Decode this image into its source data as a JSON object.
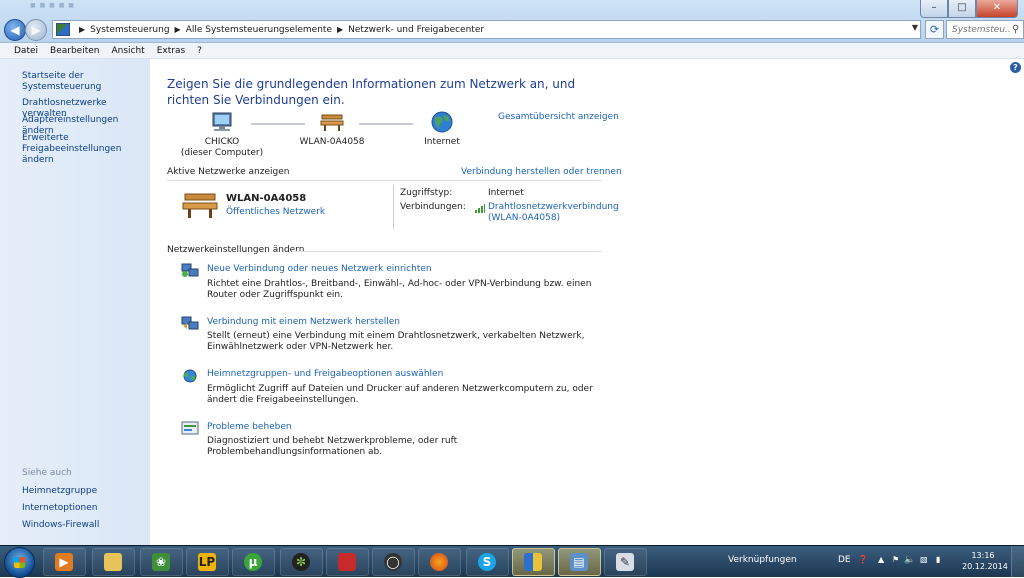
{
  "address_bar": {
    "crumbs": [
      "Systemsteuerung",
      "Alle Systemsteuerungselemente",
      "Netzwerk- und Freigabecenter"
    ],
    "search_placeholder": "Systemsteu..."
  },
  "menu": [
    "Datei",
    "Bearbeiten",
    "Ansicht",
    "Extras",
    "?"
  ],
  "sidebar": {
    "items": [
      "Startseite der Systemsteuerung",
      "Drahtlosnetzwerke verwalten",
      "Adaptereinstellungen ändern",
      "Erweiterte Freigabeeinstellungen ändern"
    ],
    "see_also_caption": "Siehe auch",
    "see_also": [
      "Heimnetzgruppe",
      "Internetoptionen",
      "Windows-Firewall"
    ]
  },
  "main": {
    "heading": "Zeigen Sie die grundlegenden Informationen zum Netzwerk an, und richten Sie Verbindungen ein.",
    "map": {
      "computer_name": "CHICKO",
      "computer_sub": "(dieser Computer)",
      "network_name": "WLAN-0A4058",
      "internet_label": "Internet",
      "full_map_link": "Gesamtübersicht anzeigen"
    },
    "active_networks": {
      "title": "Aktive Netzwerke anzeigen",
      "connect_link": "Verbindung herstellen oder trennen",
      "network_name": "WLAN-0A4058",
      "network_type": "Öffentliches Netzwerk",
      "access_type_label": "Zugriffstyp:",
      "access_type_value": "Internet",
      "connections_label": "Verbindungen:",
      "connection_line1": "Drahtlosnetzwerkverbindung",
      "connection_line2": "(WLAN-0A4058)"
    },
    "settings": {
      "title": "Netzwerkeinstellungen ändern",
      "tasks": [
        {
          "link": "Neue Verbindung oder neues Netzwerk einrichten",
          "description": "Richtet eine Drahtlos-, Breitband-, Einwähl-, Ad-hoc- oder VPN-Verbindung bzw. einen Router oder Zugriffspunkt ein."
        },
        {
          "link": "Verbindung mit einem Netzwerk herstellen",
          "description": "Stellt (erneut) eine Verbindung mit einem Drahtlosnetzwerk, verkabelten Netzwerk, Einwählnetzwerk oder VPN-Netzwerk her."
        },
        {
          "link": "Heimnetzgruppen- und Freigabeoptionen auswählen",
          "description": "Ermöglicht Zugriff auf Dateien und Drucker auf anderen Netzwerkcomputern zu, oder ändert die Freigabeeinstellungen."
        },
        {
          "link": "Probleme beheben",
          "description": "Diagnostiziert und behebt Netzwerkprobleme, oder ruft Problembehandlungsinformationen ab."
        }
      ]
    }
  },
  "taskbar": {
    "links_label": "Verknüpfungen",
    "language": "DE",
    "time": "13:16",
    "date": "20.12.2014"
  }
}
